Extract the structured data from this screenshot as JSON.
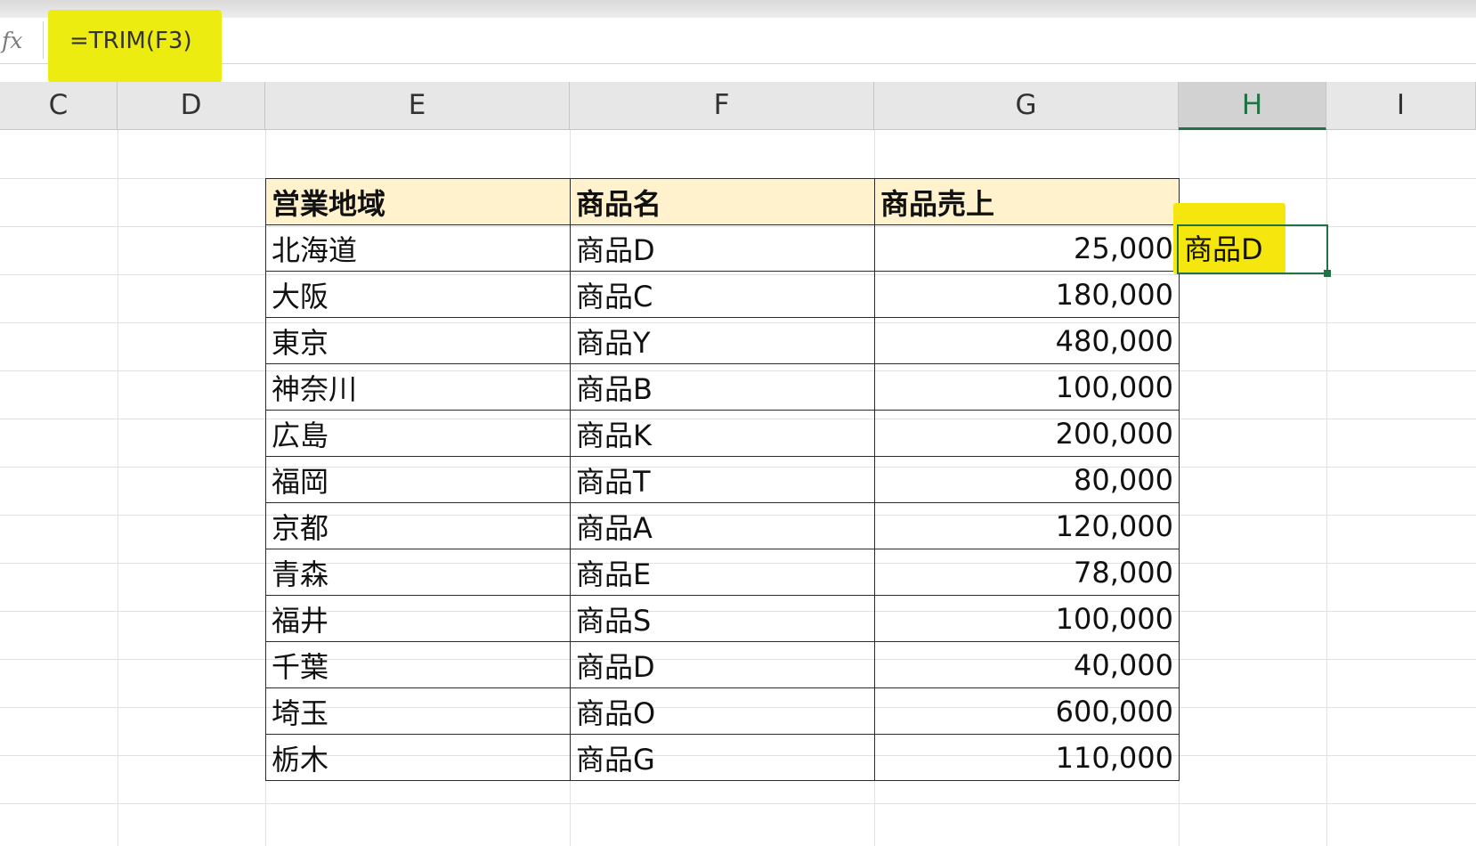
{
  "formula_bar": {
    "fx_label": "fx",
    "formula": "=TRIM(F3)"
  },
  "columns": [
    {
      "label": "C"
    },
    {
      "label": "D"
    },
    {
      "label": "E"
    },
    {
      "label": "F"
    },
    {
      "label": "G"
    },
    {
      "label": "H",
      "selected": true
    },
    {
      "label": "I"
    }
  ],
  "table": {
    "headers": [
      "営業地域",
      "商品名",
      "商品売上"
    ],
    "rows": [
      [
        "北海道",
        "商品D",
        "25,000"
      ],
      [
        "大阪",
        "商品C",
        "180,000"
      ],
      [
        "東京",
        "商品Y",
        "480,000"
      ],
      [
        "神奈川",
        "商品B",
        "100,000"
      ],
      [
        "広島",
        "商品K",
        "200,000"
      ],
      [
        "福岡",
        "商品T",
        "80,000"
      ],
      [
        "京都",
        "商品A",
        "120,000"
      ],
      [
        "青森",
        "商品E",
        "78,000"
      ],
      [
        "福井",
        "商品S",
        "100,000"
      ],
      [
        "千葉",
        "商品D",
        "40,000"
      ],
      [
        "埼玉",
        "商品O",
        "600,000"
      ],
      [
        "栃木",
        "商品G",
        "110,000"
      ]
    ]
  },
  "active_cell": {
    "value": "商品D"
  },
  "colors": {
    "header_fill": "#fff2cc",
    "highlight": "#f5e60d",
    "selection": "#217346"
  }
}
